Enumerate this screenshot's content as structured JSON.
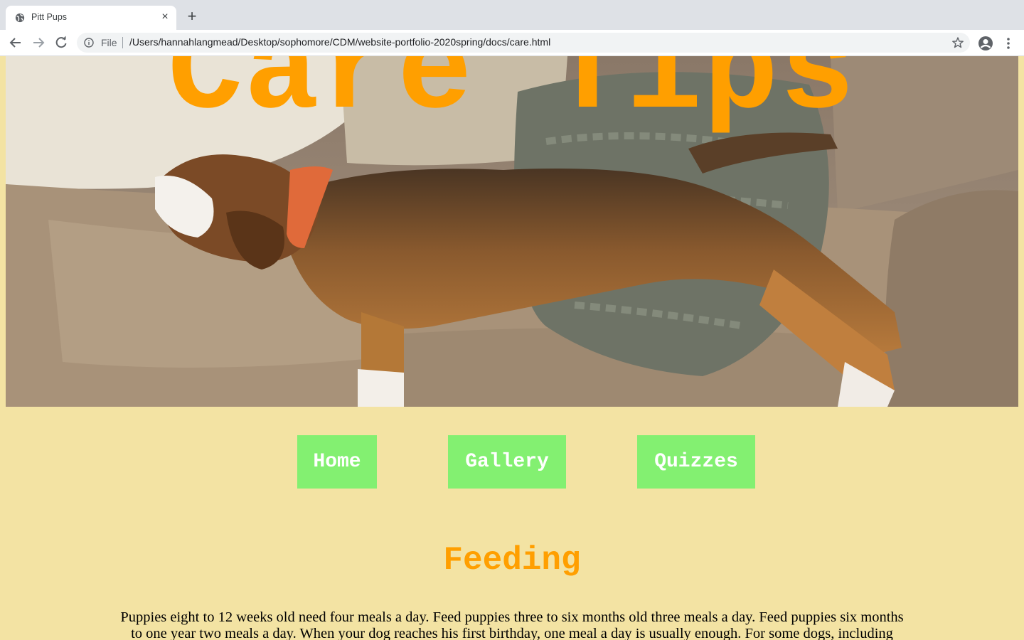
{
  "browser": {
    "tab_title": "Pitt Pups",
    "tab_close_glyph": "×",
    "new_tab_glyph": "+",
    "file_label": "File",
    "url": "/Users/hannahlangmead/Desktop/sophomore/CDM/website-portfolio-2020spring/docs/care.html",
    "icons": [
      "globe-icon",
      "back-icon",
      "forward-icon",
      "reload-icon",
      "info-icon",
      "star-icon",
      "profile-icon",
      "menu-icon"
    ]
  },
  "page": {
    "hero_title": "Care Tips",
    "nav": [
      "Home",
      "Gallery",
      "Quizzes"
    ],
    "section_heading": "Feeding",
    "section_text": "Puppies eight to 12 weeks old need four meals a day. Feed puppies three to six months old three meals a day. Feed puppies six months to one year two meals a day. When your dog reaches his first birthday, one meal a day is usually enough. For some dogs, including larger"
  },
  "colors": {
    "page_background": "#f3e3a3",
    "title_orange": "#ff9f00",
    "nav_green": "#83f071",
    "nav_text": "#ffffff"
  }
}
